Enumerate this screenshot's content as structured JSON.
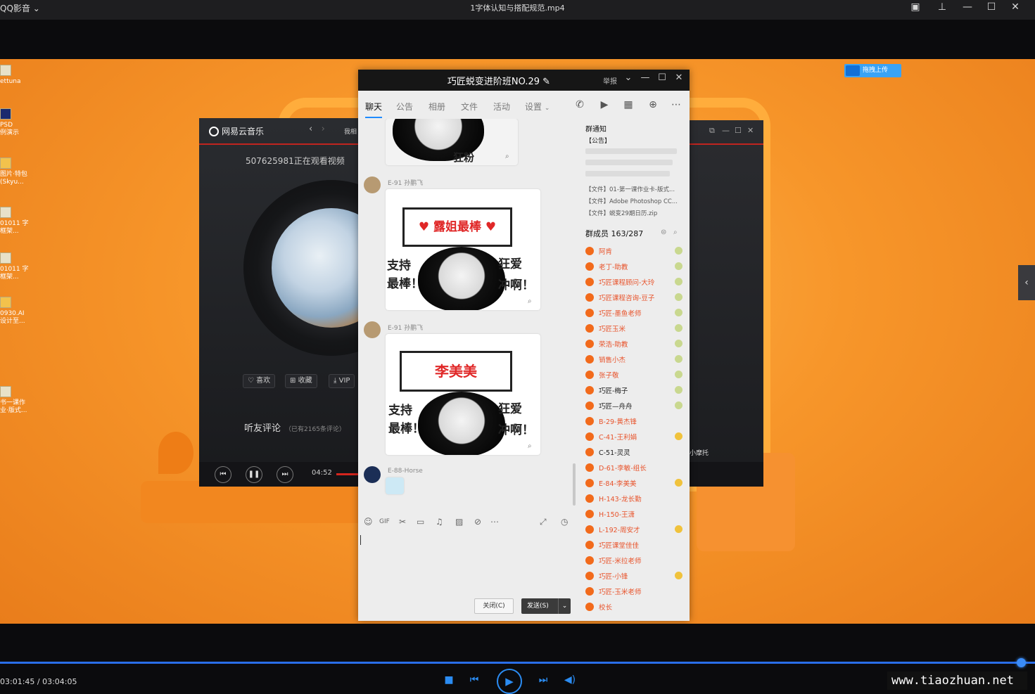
{
  "player": {
    "app_name": "QQ影音",
    "app_menu_icon": "chevron-down-icon",
    "file_name": "1字体认知与搭配规范.mp4",
    "time": "03:01:45 / 03:04:05",
    "progress": 0.987,
    "accent": "#2b8cf2"
  },
  "desktop": {
    "icons": [
      "ettuna",
      "PSD\n例演示",
      "图片·特包\n(Skyu...",
      "01011 字\n框架...",
      "01011 字\n框架...",
      "0930.AI\n设计至...",
      "书一课作\n业·版式..."
    ],
    "baidu_label": "拖拽上传"
  },
  "music": {
    "title": "网易云音乐",
    "tab_partial": "我相",
    "watching": "507625981正在观看视频",
    "btn_like": "喜欢",
    "btn_collect": "收藏",
    "btn_vip": "VIP",
    "comments_title": "听友评论",
    "comments_count": "（已有2165条评论）",
    "time": "04:52"
  },
  "dark2": {
    "label": "小摩托"
  },
  "qq": {
    "group_name": "巧匠蜕变进阶班NO.29",
    "report": "举报",
    "tabs": [
      "聊天",
      "公告",
      "相册",
      "文件",
      "活动",
      "设置"
    ],
    "messages": [
      {
        "sender": "E-91 孙鹏飞",
        "sticker_sign": "♥ 露姐最棒 ♥",
        "left_text": "支持\n最棒！",
        "right_text": "狂爱\n冲啊！"
      },
      {
        "sender": "E-91 孙鹏飞",
        "sticker_sign": "李美美",
        "left_text": "支持\n最棒！",
        "right_text": "狂爱\n冲啊！"
      },
      {
        "sender": "E-88-Horse"
      }
    ],
    "sticker_fragment": "狂粉",
    "notice_title": "群通知",
    "notice_tag": "【公告】",
    "files": [
      "【文件】01-第一课作业卡-版式...",
      "【文件】Adobe Photoshop CC...",
      "【文件】蜕变29期日历.zip"
    ],
    "members_label": "群成员 163/287",
    "members": [
      {
        "name": "阿肯",
        "color": "#e8532b"
      },
      {
        "name": "老丁-助教",
        "color": "#e8532b"
      },
      {
        "name": "巧匠课程顾问-大玲",
        "color": "#e8532b"
      },
      {
        "name": "巧匠课程咨询-豆子",
        "color": "#e8532b"
      },
      {
        "name": "巧匠-墨鱼老师",
        "color": "#e8532b"
      },
      {
        "name": "巧匠玉米",
        "color": "#e8532b"
      },
      {
        "name": "荣浩-助教",
        "color": "#e8532b"
      },
      {
        "name": "销售小杰",
        "color": "#e8532b"
      },
      {
        "name": "张子敬",
        "color": "#e8532b"
      },
      {
        "name": "巧匠-梅子",
        "color": "#222222"
      },
      {
        "name": "巧匠—舟舟",
        "color": "#222222"
      },
      {
        "name": "B-29-黄杰锋",
        "color": "#e8532b"
      },
      {
        "name": "C-41-王利娟",
        "color": "#e8532b"
      },
      {
        "name": "C-51-灵灵",
        "color": "#222222"
      },
      {
        "name": "D-61-李敏-组长",
        "color": "#e8532b"
      },
      {
        "name": "E-84-李美美",
        "color": "#e8532b"
      },
      {
        "name": "H-143-龙长勤",
        "color": "#e8532b"
      },
      {
        "name": "H-150-王潇",
        "color": "#e8532b"
      },
      {
        "name": "L-192-周安才",
        "color": "#e8532b"
      },
      {
        "name": "巧匠课堂佳佳",
        "color": "#e8532b"
      },
      {
        "name": "巧匠-米拉老师",
        "color": "#e8532b"
      },
      {
        "name": "巧匠-小锋",
        "color": "#e8532b"
      },
      {
        "name": "巧匠-玉米老师",
        "color": "#e8532b"
      },
      {
        "name": "校长",
        "color": "#e8532b"
      }
    ],
    "btn_close": "关闭(C)",
    "btn_send": "发送(S)"
  },
  "watermark": "www.tiaozhuan.net"
}
